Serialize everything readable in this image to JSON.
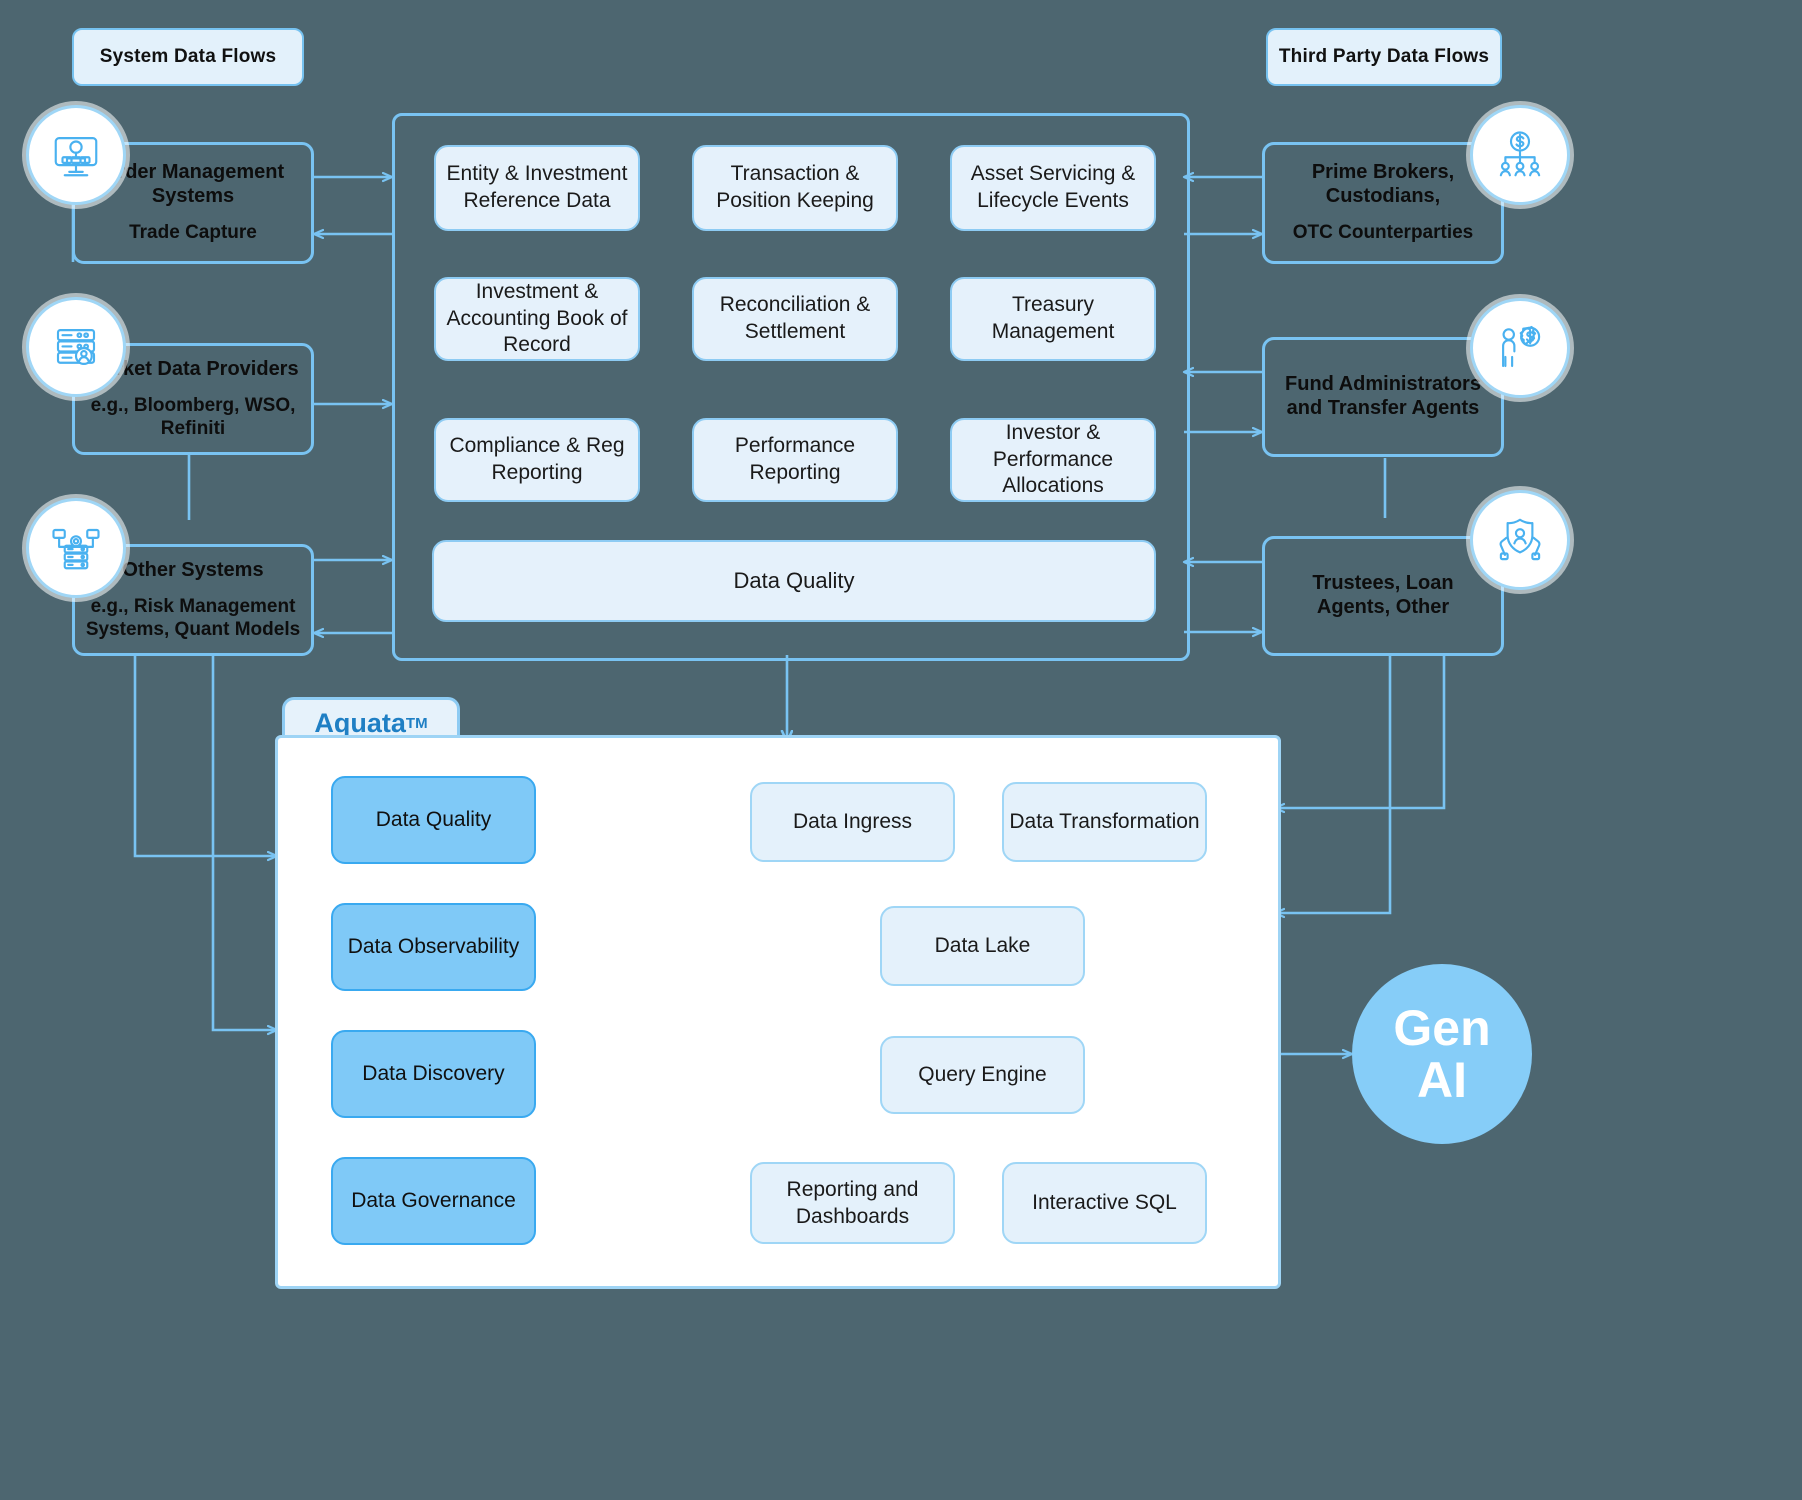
{
  "diagram": {
    "title_left": "System Data Flows",
    "title_right": "Third Party Data Flows",
    "background_color": "#4d6670",
    "accent_color": "#79c3f2",
    "brand_color": "#1f7fc4"
  },
  "left_sources": [
    {
      "name": "Order Management Systems",
      "sub": "Trade Capture",
      "icon": "monitor-gear-icon"
    },
    {
      "name": "Market Data Providers",
      "sub": "e.g., Bloomberg, WSO, Refiniti",
      "icon": "database-user-icon"
    },
    {
      "name": "Other Systems",
      "sub": "e.g., Risk Management Systems, Quant Models",
      "icon": "server-network-icon"
    }
  ],
  "right_sources": [
    {
      "name": "Prime Brokers, Custodians,",
      "sub": "OTC Counterparties",
      "icon": "dollar-hierarchy-icon"
    },
    {
      "name": "Fund Administrators and Transfer Agents",
      "sub": "",
      "icon": "person-dollar-gear-icon"
    },
    {
      "name": "Trustees, Loan Agents, Other",
      "sub": "",
      "icon": "shield-person-hands-icon"
    }
  ],
  "core": {
    "capabilities": [
      "Entity & Investment Reference Data",
      "Transaction & Position Keeping",
      "Asset Servicing & Lifecycle Events",
      "Investment & Accounting Book of Record",
      "Reconciliation & Settlement",
      "Treasury Management",
      "Compliance & Reg Reporting",
      "Performance Reporting",
      "Investor & Performance Allocations"
    ],
    "data_quality_bar": "Data Quality"
  },
  "aquata": {
    "tab_label": "Aquata",
    "tab_superscript": "TM",
    "governance": [
      "Data Quality",
      "Data Observability",
      "Data Discovery",
      "Data Governance"
    ],
    "pipeline": {
      "ingress": "Data Ingress",
      "transformation": "Data Transformation",
      "lake": "Data Lake",
      "query_engine": "Query Engine",
      "reporting": "Reporting and Dashboards",
      "interactive_sql": "Interactive SQL"
    }
  },
  "gen_ai": {
    "line1": "Gen",
    "line2": "AI"
  }
}
